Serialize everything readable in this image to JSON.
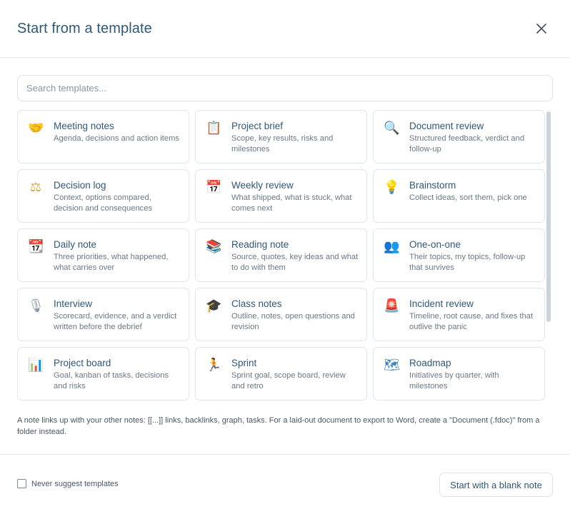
{
  "dialog": {
    "title": "Start from a template",
    "close_label": "Close"
  },
  "search": {
    "placeholder": "Search templates...",
    "value": ""
  },
  "templates": [
    {
      "icon": "handshake-icon",
      "glyph": "🤝",
      "color": "#f0a31c",
      "title": "Meeting notes",
      "description": "Agenda, decisions and action items"
    },
    {
      "icon": "clipboard-icon",
      "glyph": "📋",
      "color": "#b5875a",
      "title": "Project brief",
      "description": "Scope, key results, risks and milestones"
    },
    {
      "icon": "magnifier-icon",
      "glyph": "🔍",
      "color": "#3a6fb0",
      "title": "Document review",
      "description": "Structured feedback, verdict and follow-up"
    },
    {
      "icon": "balance-scale-icon",
      "glyph": "⚖",
      "color": "#d9a441",
      "title": "Decision log",
      "description": "Context, options compared, decision and consequences"
    },
    {
      "icon": "calendar-icon",
      "glyph": "📅",
      "color": "#6a8fc8",
      "title": "Weekly review",
      "description": "What shipped, what is stuck, what comes next"
    },
    {
      "icon": "lightbulb-icon",
      "glyph": "💡",
      "color": "#f2c230",
      "title": "Brainstorm",
      "description": "Collect ideas, sort them, pick one"
    },
    {
      "icon": "calendar-icon",
      "glyph": "📆",
      "color": "#6a8fc8",
      "title": "Daily note",
      "description": "Three priorities, what happened, what carries over"
    },
    {
      "icon": "books-icon",
      "glyph": "📚",
      "color": "#d3463f",
      "title": "Reading note",
      "description": "Source, quotes, key ideas and what to do with them"
    },
    {
      "icon": "two-people-icon",
      "glyph": "👥",
      "color": "#4a3170",
      "title": "One-on-one",
      "description": "Their topics, my topics, follow-up that survives"
    },
    {
      "icon": "microphone-icon",
      "glyph": "🎙",
      "color": "#8b96a2",
      "title": "Interview",
      "description": "Scorecard, evidence, and a verdict written before the debrief"
    },
    {
      "icon": "graduation-cap-icon",
      "glyph": "🎓",
      "color": "#2b2f36",
      "title": "Class notes",
      "description": "Outline, notes, open questions and revision"
    },
    {
      "icon": "siren-icon",
      "glyph": "🚨",
      "color": "#e0393e",
      "title": "Incident review",
      "description": "Timeline, root cause, and fixes that outlive the panic"
    },
    {
      "icon": "bar-chart-icon",
      "glyph": "📊",
      "color": "#4b86c5",
      "title": "Project board",
      "description": "Goal, kanban of tasks, decisions and risks"
    },
    {
      "icon": "runner-icon",
      "glyph": "🏃",
      "color": "#e89a3c",
      "title": "Sprint",
      "description": "Sprint goal, scope board, review and retro"
    },
    {
      "icon": "map-icon",
      "glyph": "🗺",
      "color": "#3f86b8",
      "title": "Roadmap",
      "description": "Initiatives by quarter, with milestones"
    }
  ],
  "info_text": "A note links up with your other notes: [[...]] links, backlinks, graph, tasks. For a laid-out document to export to Word, create a \"Document (.fdoc)\" from a folder instead.",
  "footer": {
    "never_suggest_label": "Never suggest templates",
    "never_suggest_checked": false,
    "blank_button_label": "Start with a blank note"
  }
}
